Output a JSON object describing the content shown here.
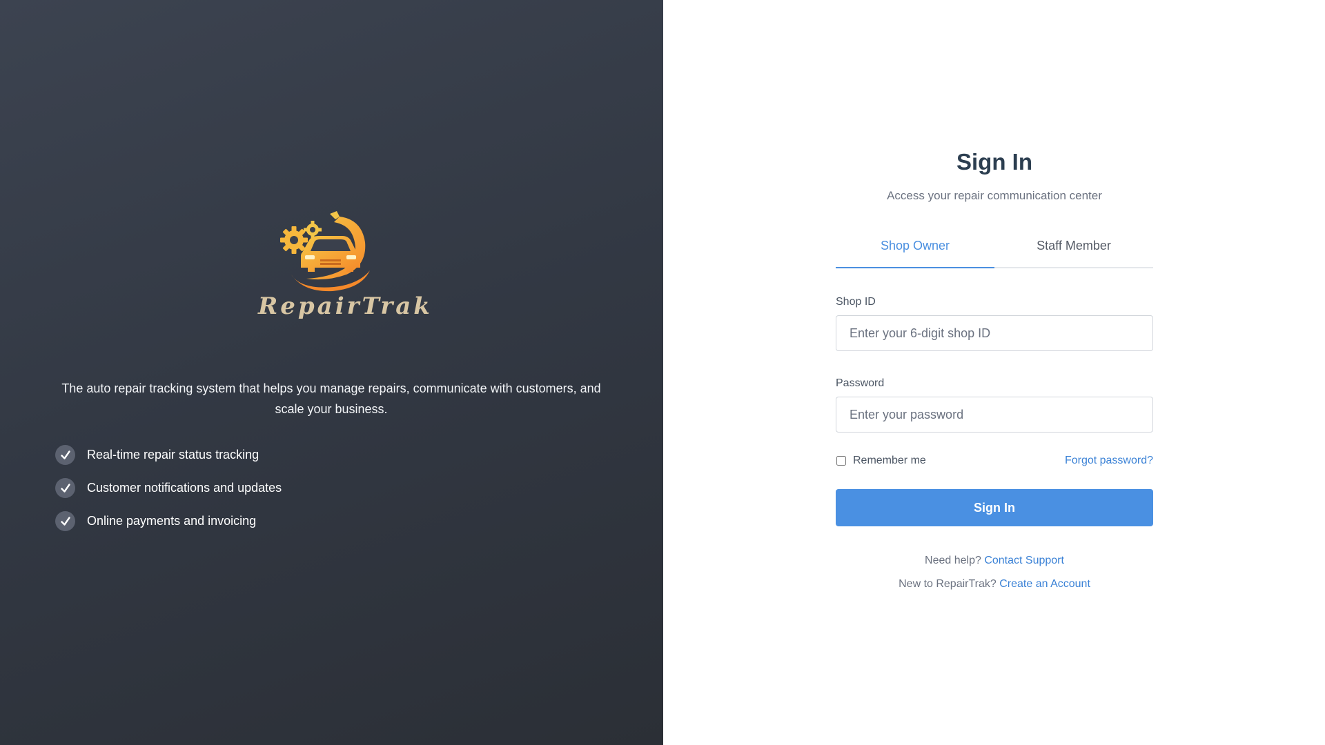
{
  "brand": {
    "name": "RepairTrak",
    "tagline": "The auto repair tracking system that helps you manage repairs, communicate with customers, and scale your business.",
    "features": [
      "Real-time repair status tracking",
      "Customer notifications and updates",
      "Online payments and invoicing"
    ],
    "colors": {
      "panel": "#323843",
      "logo_orange": "#f59a2c",
      "logo_gold": "#f3c548",
      "wordmark": "#d8c6a4"
    },
    "icons": {
      "logo": "car-gear-wrench-logo",
      "feature_bullet": "check-icon"
    }
  },
  "signin": {
    "title": "Sign In",
    "subtitle": "Access your repair communication center",
    "tabs": [
      {
        "label": "Shop Owner",
        "active": true
      },
      {
        "label": "Staff Member",
        "active": false
      }
    ],
    "shop_id": {
      "label": "Shop ID",
      "placeholder": "Enter your 6-digit shop ID",
      "value": ""
    },
    "password": {
      "label": "Password",
      "placeholder": "Enter your password",
      "value": ""
    },
    "remember_label": "Remember me",
    "remember_checked": false,
    "forgot_label": "Forgot password?",
    "submit_label": "Sign In",
    "help_text": "Need help?",
    "help_link": "Contact Support",
    "new_text": "New to RepairTrak?",
    "new_link": "Create an Account",
    "colors": {
      "accent": "#4a90e2",
      "link": "#3b82d6",
      "title": "#2c3e50"
    }
  }
}
